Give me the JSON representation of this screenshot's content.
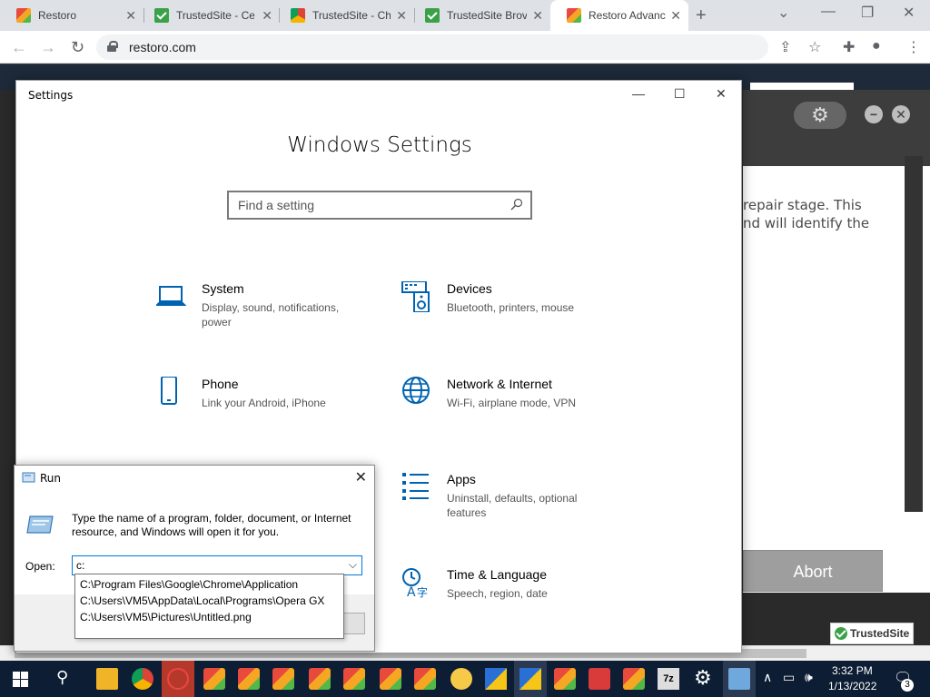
{
  "browser": {
    "tabs": [
      {
        "label": "Restoro",
        "favicon": "restoro-icon"
      },
      {
        "label": "TrustedSite - Ce",
        "favicon": "trustedsite-icon"
      },
      {
        "label": "TrustedSite - Ch",
        "favicon": "chrome-icon"
      },
      {
        "label": "TrustedSite Brov",
        "favicon": "trustedsite-icon"
      },
      {
        "label": "Restoro Advanc",
        "favicon": "restoro-icon",
        "active": true
      }
    ],
    "url": "restoro.com"
  },
  "page": {
    "text_line1": "repair stage. This",
    "text_line2": "nd will identify the",
    "abort_label": "Abort",
    "trusted_badge": "TrustedSite"
  },
  "settings": {
    "window_title": "Settings",
    "heading": "Windows Settings",
    "search_placeholder": "Find a setting",
    "categories": [
      {
        "name": "System",
        "desc": "Display, sound, notifications, power",
        "icon": "laptop-icon"
      },
      {
        "name": "Devices",
        "desc": "Bluetooth, printers, mouse",
        "icon": "devices-icon"
      },
      {
        "name": "Phone",
        "desc": "Link your Android, iPhone",
        "icon": "phone-icon"
      },
      {
        "name": "Network & Internet",
        "desc": "Wi-Fi, airplane mode, VPN",
        "icon": "globe-icon"
      },
      {
        "name": "Apps",
        "desc": "Uninstall, defaults, optional features",
        "icon": "apps-list-icon"
      },
      {
        "name": "Time & Language",
        "desc": "Speech, region, date",
        "icon": "time-language-icon"
      }
    ]
  },
  "run": {
    "title": "Run",
    "description": "Type the name of a program, folder, document, or Internet resource, and Windows will open it for you.",
    "open_label": "Open:",
    "open_value": "c:",
    "suggestions": [
      "C:\\Program Files\\Google\\Chrome\\Application",
      "C:\\Users\\VM5\\AppData\\Local\\Programs\\Opera GX",
      "C:\\Users\\VM5\\Pictures\\Untitled.png"
    ]
  },
  "taskbar": {
    "time": "3:32 PM",
    "date": "1/13/2022",
    "notification_count": "3",
    "sevenzip_label": "7z"
  }
}
